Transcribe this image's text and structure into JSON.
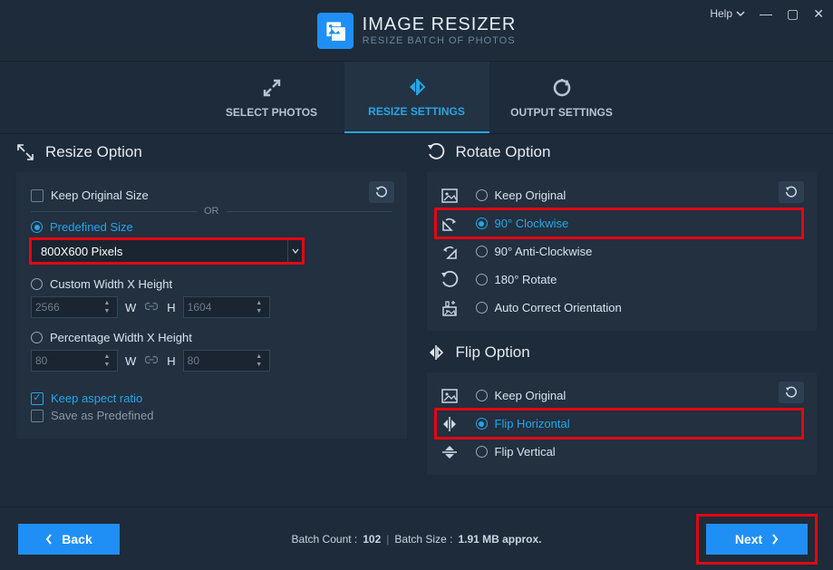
{
  "window": {
    "help": "Help",
    "title": "IMAGE RESIZER",
    "subtitle": "RESIZE BATCH OF PHOTOS"
  },
  "tabs": {
    "select_photos": "SELECT PHOTOS",
    "resize_settings": "RESIZE SETTINGS",
    "output_settings": "OUTPUT SETTINGS"
  },
  "resize": {
    "title": "Resize Option",
    "keep_original": "Keep Original Size",
    "or": "OR",
    "predefined": "Predefined Size",
    "dropdown_value": "800X600 Pixels",
    "custom": "Custom Width X Height",
    "custom_w": "2566",
    "custom_h": "1604",
    "w": "W",
    "h": "H",
    "percentage": "Percentage Width X Height",
    "pct_w": "80",
    "pct_h": "80",
    "keep_aspect": "Keep aspect ratio",
    "save_predef": "Save as Predefined"
  },
  "rotate": {
    "title": "Rotate Option",
    "keep_original": "Keep Original",
    "cw": "90° Clockwise",
    "acw": "90° Anti-Clockwise",
    "one80": "180° Rotate",
    "auto": "Auto Correct Orientation"
  },
  "flip": {
    "title": "Flip Option",
    "keep_original": "Keep Original",
    "horizontal": "Flip Horizontal",
    "vertical": "Flip Vertical"
  },
  "footer": {
    "back": "Back",
    "next": "Next",
    "batch_count_label": "Batch Count :",
    "batch_count": "102",
    "batch_size_label": "Batch Size :",
    "batch_size": "1.91 MB approx."
  }
}
